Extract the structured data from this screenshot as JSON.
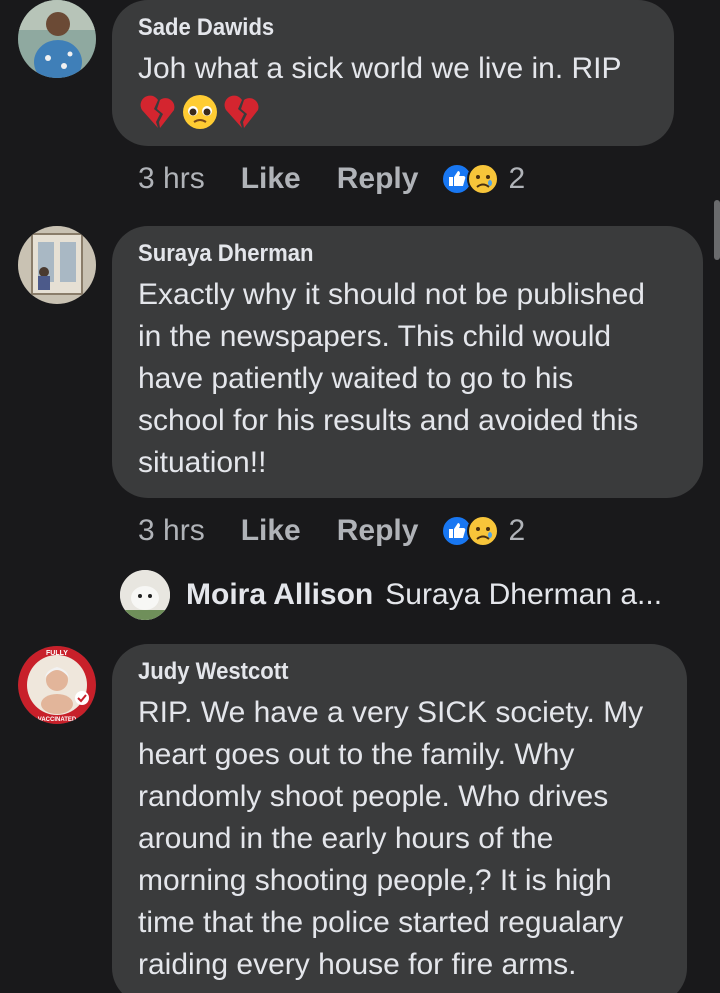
{
  "comments": [
    {
      "author": "Sade Dawids",
      "text": "Joh what a sick world we live in. RIP",
      "emojis": [
        "broken-heart-emoji",
        "pleading-face-emoji",
        "broken-heart-emoji"
      ],
      "time": "3 hrs",
      "like_label": "Like",
      "reply_label": "Reply",
      "reaction_count": "2"
    },
    {
      "author": "Suraya Dherman",
      "text": "Exactly why it should not be published\nin the newspapers. This child would\nhave patiently waited to go to his\nschool for his results and avoided this\nsituation!!",
      "time": "3 hrs",
      "like_label": "Like",
      "reply_label": "Reply",
      "reaction_count": "2"
    },
    {
      "author": "Judy Westcott",
      "text": "RIP. We have a very SICK society. My\nheart goes out to the family. Why\nrandomly shoot people. Who drives\naround in the early hours of the\nmorning shooting people,? It is high\ntime that the police started regualary\nraiding every house for fire arms.",
      "avatar_badge_top": "FULLY",
      "avatar_badge_bottom": "VACCINATED"
    }
  ],
  "reply_preview": {
    "author": "Moira Allison",
    "text": "Suraya Dherman a..."
  },
  "colors": {
    "background": "#19191b",
    "bubble": "#3a3b3c",
    "text": "#e4e6eb",
    "secondary_text": "#b0b3b8",
    "like_blue": "#1877f2",
    "badge_red": "#c8202a"
  }
}
